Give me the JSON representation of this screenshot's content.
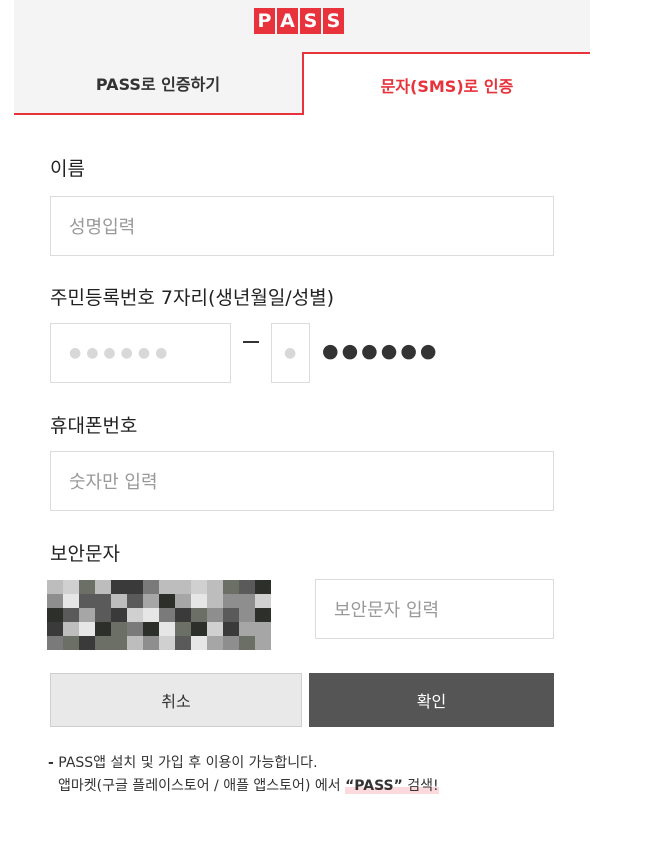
{
  "logo": {
    "letters": [
      "P",
      "A",
      "S",
      "S"
    ],
    "color": "#e8323c"
  },
  "tabs": {
    "pass_label": "PASS로 인증하기",
    "sms_label": "문자(SMS)로 인증"
  },
  "name": {
    "label": "이름",
    "placeholder": "성명입력"
  },
  "rrn": {
    "label": "주민등록번호 7자리(생년월일/성별)",
    "birth_mask": "●●●●●●",
    "gender_mask": "●",
    "hidden_mask": "●●●●●●"
  },
  "phone": {
    "label": "휴대폰번호",
    "placeholder": "숫자만 입력"
  },
  "captcha": {
    "label": "보안문자",
    "placeholder": "보안문자 입력"
  },
  "buttons": {
    "cancel": "취소",
    "confirm": "확인"
  },
  "notice": {
    "line1": "PASS앱 설치 및 가입 후 이용이 가능합니다.",
    "line2_prefix": "앱마켓(구글 플레이스토어 / 애플 앱스토어) 에서",
    "line2_quote": "“PASS”",
    "line2_suffix": "검색!"
  },
  "colors": {
    "accent": "#e8323c",
    "confirm_bg": "#555555",
    "cancel_bg": "#e9e9e9"
  }
}
